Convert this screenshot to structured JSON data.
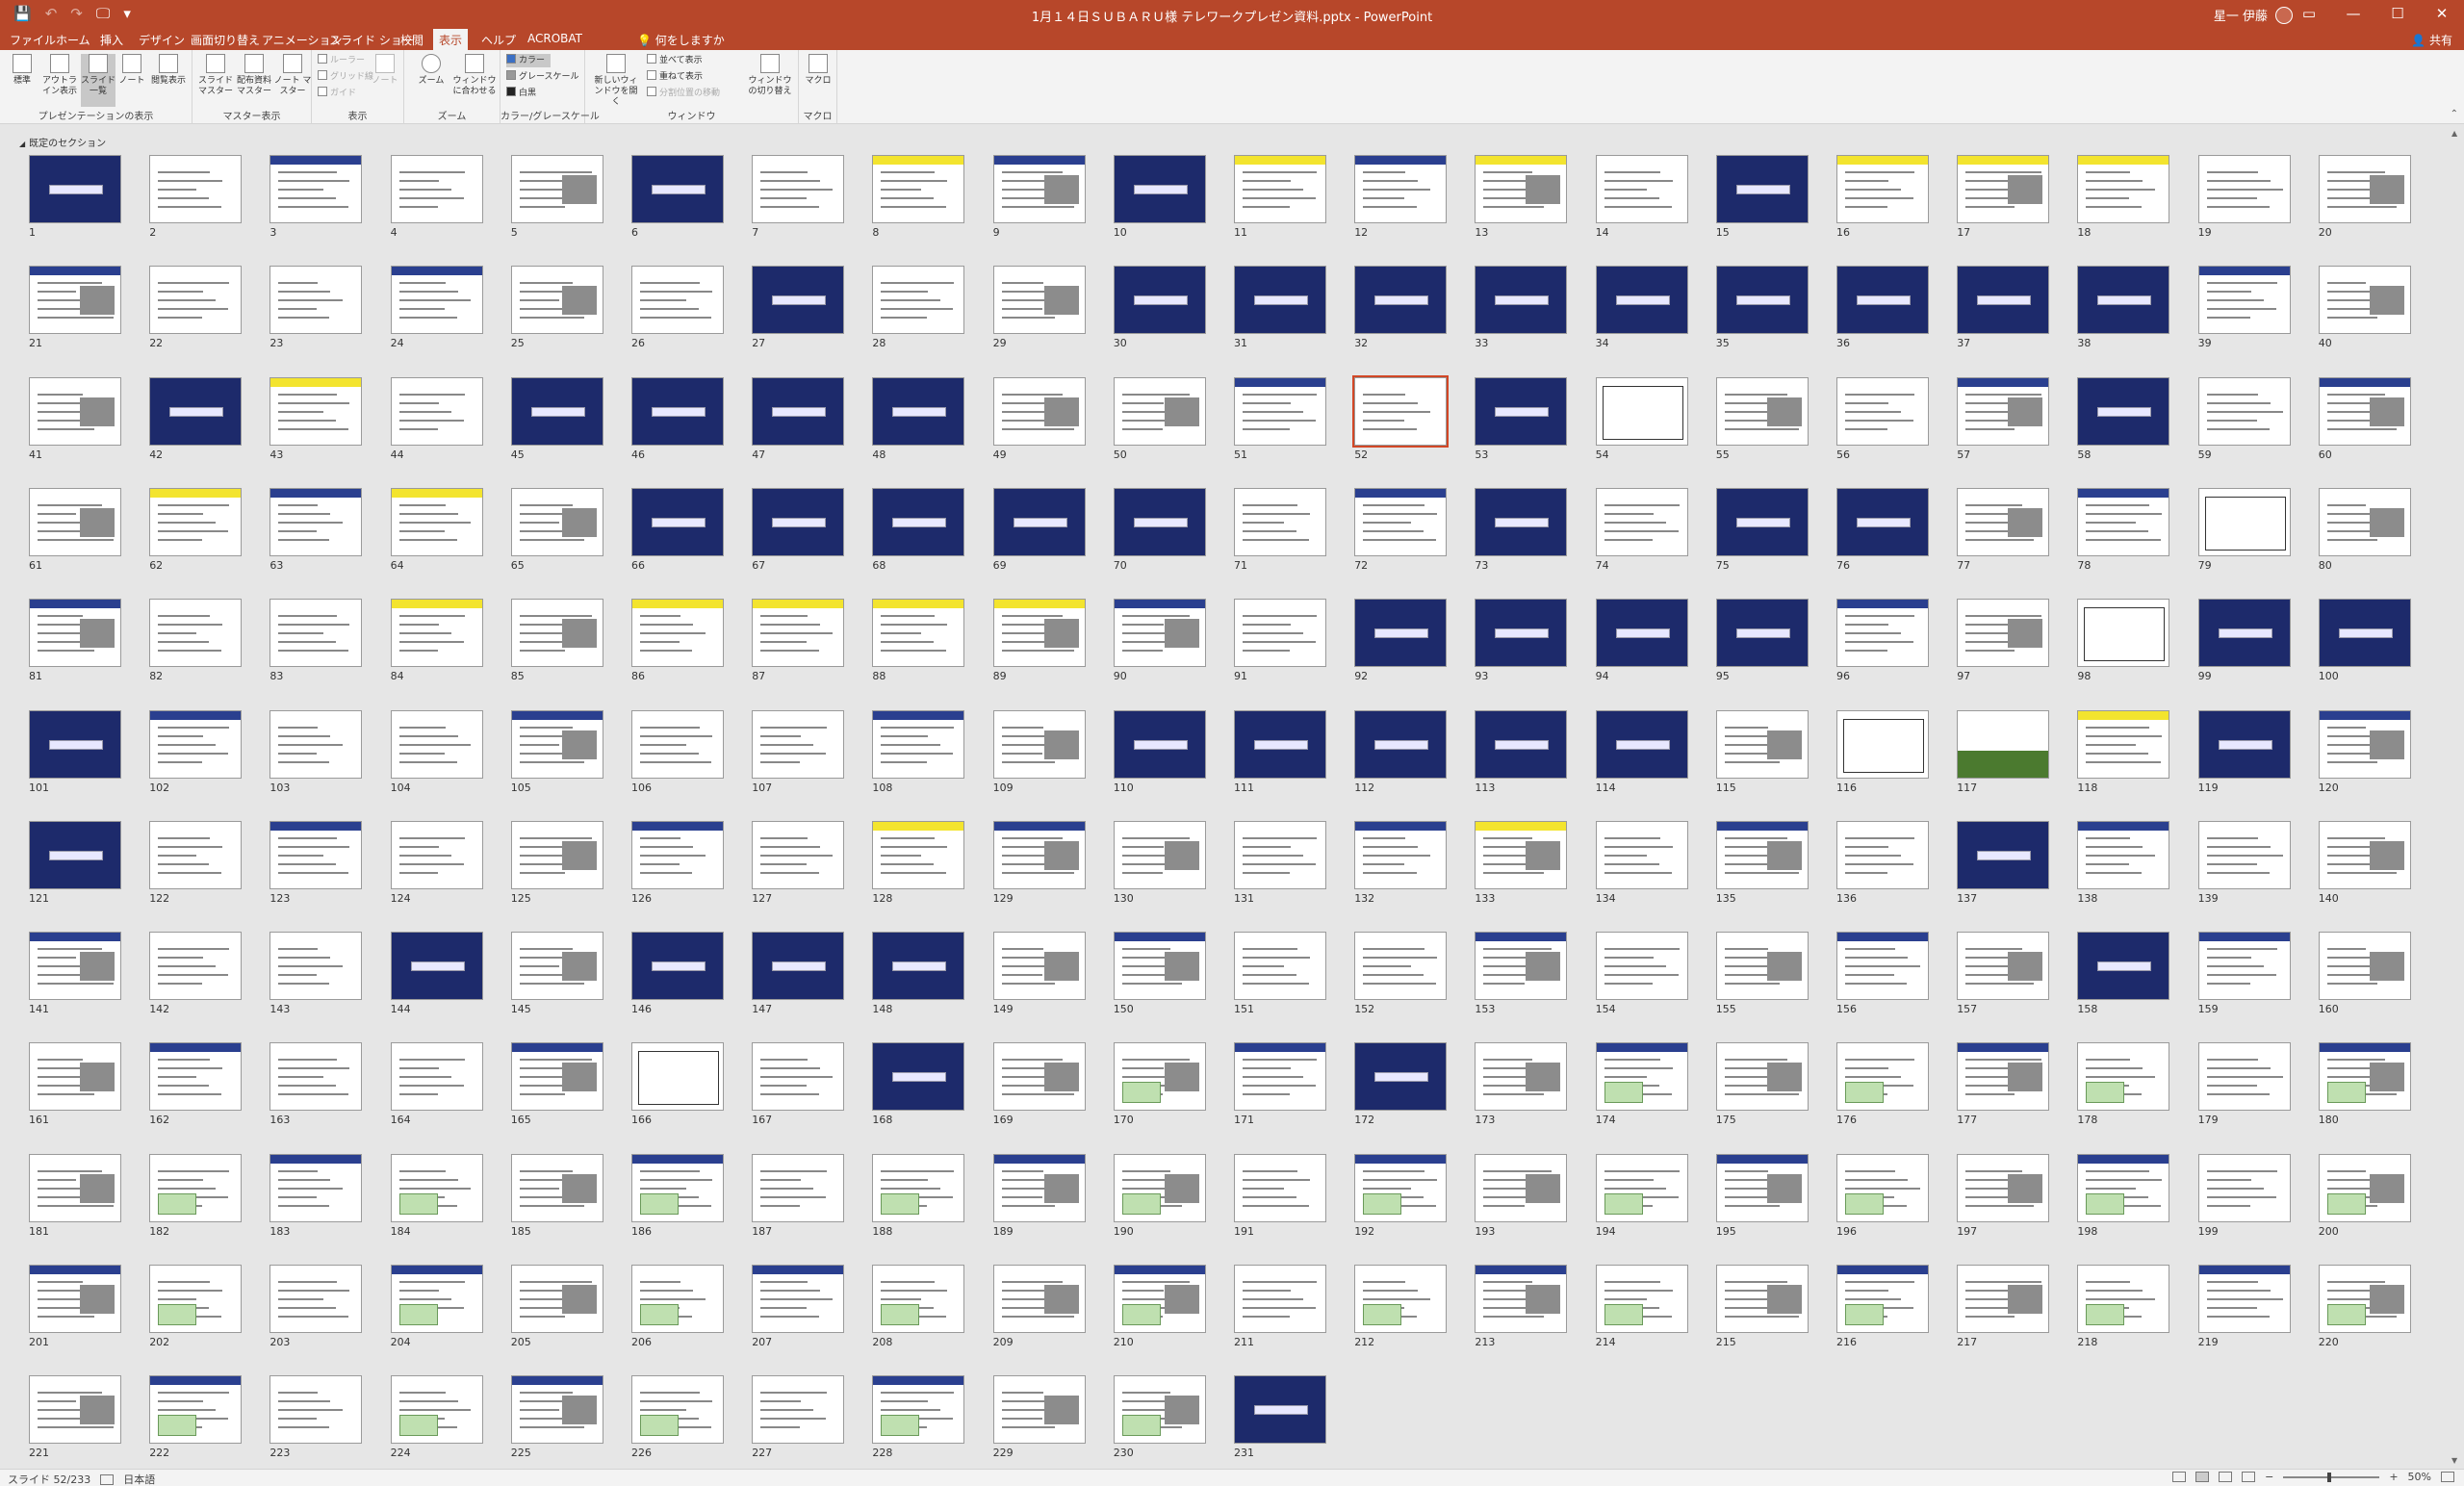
{
  "window": {
    "title": "1月１４日ＳＵＢＡＲＵ様 テレワークプレゼン資料.pptx  -  PowerPoint",
    "user": "星一 伊藤",
    "controls": [
      "▭",
      "—",
      "☐",
      "✕"
    ]
  },
  "qat": {
    "save": "💾",
    "undo": "↶",
    "redo": "↷",
    "start": "🖵",
    "more": "▾"
  },
  "tabs": [
    "ファイル",
    "ホーム",
    "挿入",
    "デザイン",
    "画面切り替え",
    "アニメーション",
    "スライド ショー",
    "校閲",
    "表示",
    "ヘルプ",
    "ACROBAT"
  ],
  "active_tab": "表示",
  "tell_me": "何をしますか",
  "share": "共有",
  "ribbon": {
    "groups": {
      "views": "プレゼンテーションの表示",
      "master": "マスター表示",
      "show": "表示",
      "zoom": "ズーム",
      "color": "カラー/グレースケール",
      "window": "ウィンドウ",
      "macro": "マクロ"
    },
    "buttons": {
      "normal": "標準",
      "outline": "アウトライン表示",
      "sorter": "スライド一覧",
      "notes": "ノート",
      "reading": "閲覧表示",
      "slide_master": "スライド マスター",
      "handout_master": "配布資料 マスター",
      "notes_master": "ノート マスター",
      "ruler": "ルーラー",
      "gridlines": "グリッド線",
      "guides": "ガイド",
      "notes_btn": "ノート",
      "zoom": "ズーム",
      "fit": "ウィンドウに合わせる",
      "color": "カラー",
      "grayscale": "グレースケール",
      "bw": "白黒",
      "new_window": "新しいウィンドウを開く",
      "arrange": "並べて表示",
      "cascade": "重ねて表示",
      "move_split": "分割位置の移動",
      "switch": "ウィンドウの切り替え",
      "macro": "マクロ"
    }
  },
  "section": "既定のセクション",
  "slides": {
    "count": 231,
    "current": 52,
    "per_row": 20
  },
  "status": {
    "slide_info": "スライド 52/233",
    "language": "日本語",
    "zoom": "50%"
  }
}
